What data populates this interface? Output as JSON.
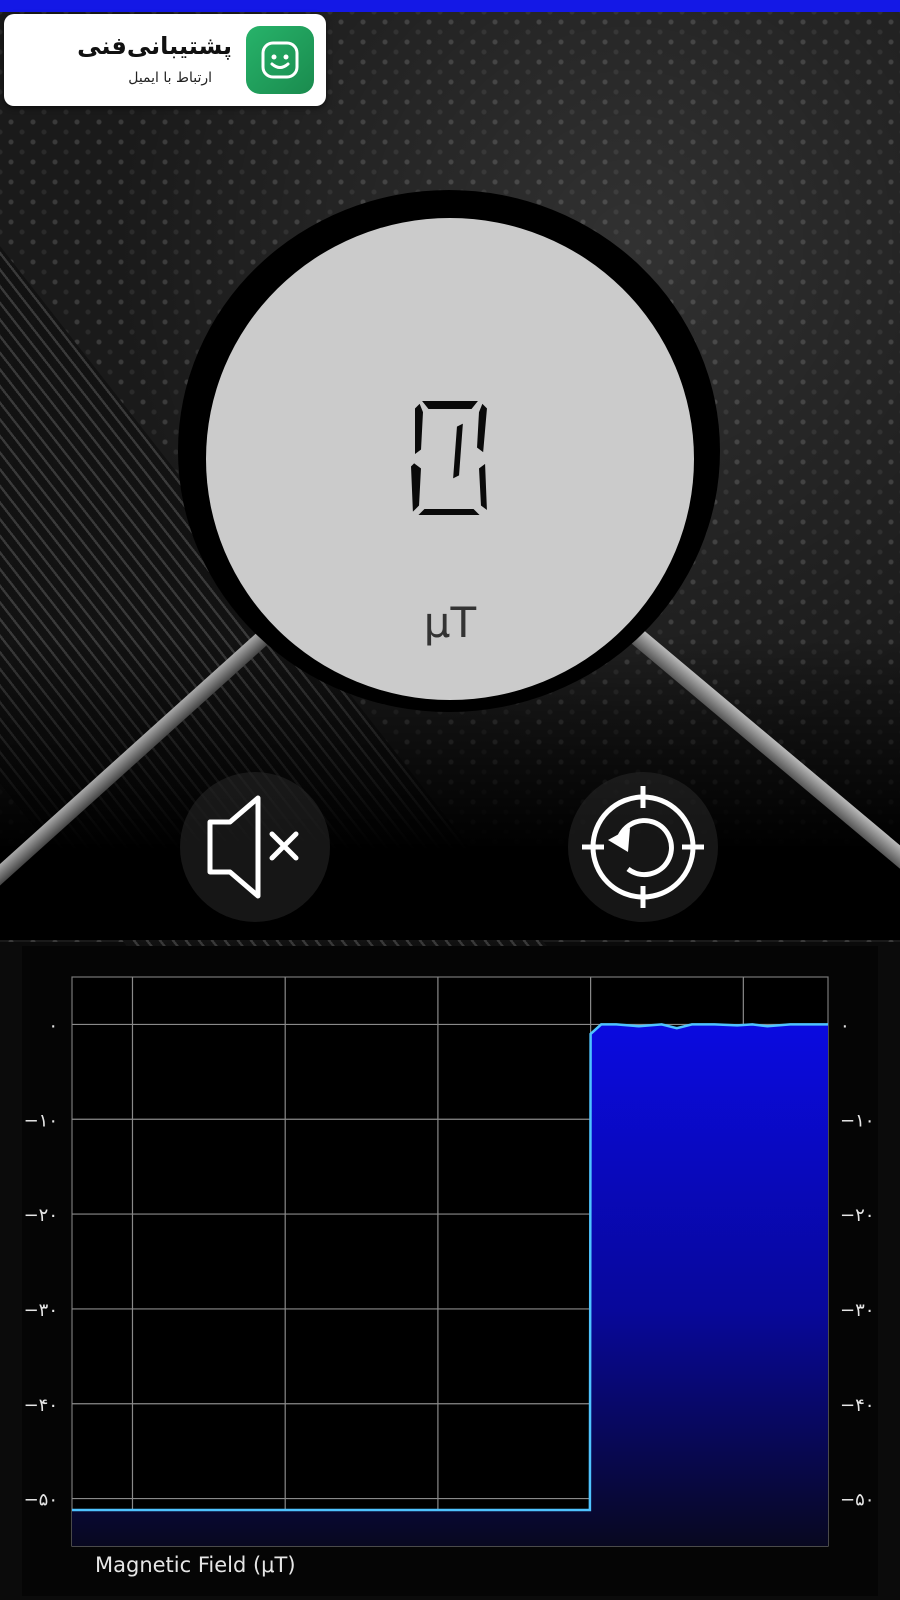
{
  "ad": {
    "title": "پشتیبانی‌فنی",
    "subtitle": "ارتباط با ایمیل",
    "icon": "smiley-chat-icon"
  },
  "meter": {
    "value": "0",
    "unit": "μT"
  },
  "controls": {
    "mute_icon": "speaker-mute-icon",
    "reset_icon": "crosshair-reset-icon"
  },
  "colors": {
    "status_bar": "#1418e6",
    "fill_top": "#0a0ae0",
    "line": "#4fc3ff"
  },
  "chart_data": {
    "type": "area",
    "xlabel": "Magnetic Field (μT)",
    "ylabel": "",
    "yticks_left": [
      "۰",
      "−۱۰",
      "−۲۰",
      "−۳۰",
      "−۴۰",
      "−۵۰"
    ],
    "yticks_right": [
      "۰",
      "−۱۰",
      "−۲۰",
      "−۳۰",
      "−۴۰",
      "−۵۰"
    ],
    "ytick_values": [
      0,
      -10,
      -20,
      -30,
      -40,
      -50
    ],
    "ylim": [
      -55,
      5
    ],
    "xlim": [
      0,
      100
    ],
    "grid": true,
    "series": [
      {
        "x": [
          0,
          68.5,
          68.6,
          70,
          72,
          75,
          78,
          80,
          82,
          85,
          88,
          90,
          92,
          95,
          98,
          100
        ],
        "y": [
          -51.2,
          -51.2,
          -1,
          0,
          0,
          -0.2,
          0,
          -0.4,
          0,
          0,
          -0.1,
          0,
          -0.2,
          0,
          0,
          0
        ]
      }
    ]
  }
}
